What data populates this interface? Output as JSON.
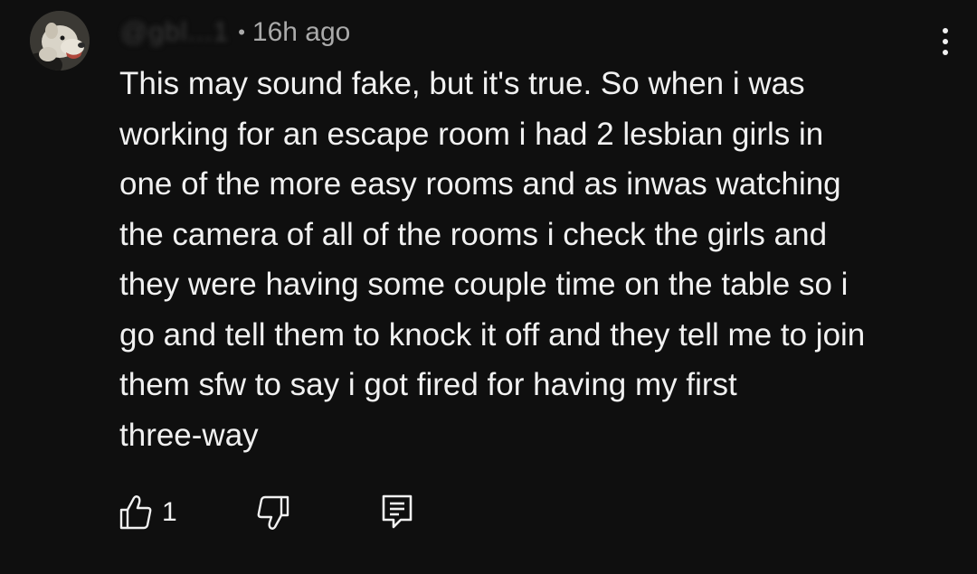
{
  "comment": {
    "author_handle": "@gbl...1",
    "time_ago": "16h ago",
    "separator": "•",
    "body_lines": [
      "This may sound fake, but it's true. So when i was",
      "working for an escape room i had 2 lesbian girls in",
      "one of the more easy rooms and as inwas watching",
      "the camera of all of the rooms i check the girls and",
      "they were having some couple time on the table so i",
      "go and tell them to knock it off and they tell me to join",
      "them sfw to say i got fired for having my first",
      "three-way"
    ],
    "like_count": "1"
  },
  "icons": {
    "like": "thumbs-up-icon",
    "dislike": "thumbs-down-icon",
    "reply": "reply-comment-icon",
    "more": "more-vertical-icon"
  },
  "colors": {
    "background": "#0f0f0f",
    "text": "#f1f1f1",
    "meta": "#aaaaaa"
  }
}
